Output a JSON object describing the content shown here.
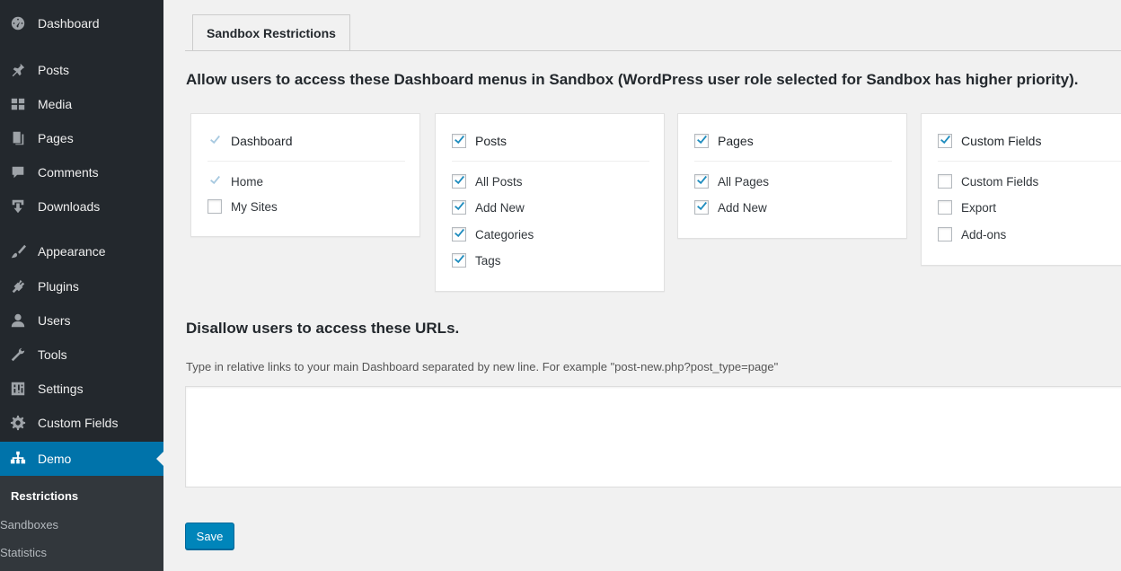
{
  "sidebar": {
    "items": [
      {
        "label": "Dashboard",
        "icon": "dashboard-icon"
      },
      {
        "label": "Posts",
        "icon": "pin-icon"
      },
      {
        "label": "Media",
        "icon": "media-icon"
      },
      {
        "label": "Pages",
        "icon": "pages-icon"
      },
      {
        "label": "Comments",
        "icon": "comment-icon"
      },
      {
        "label": "Downloads",
        "icon": "download-icon"
      },
      {
        "label": "Appearance",
        "icon": "brush-icon"
      },
      {
        "label": "Plugins",
        "icon": "plug-icon"
      },
      {
        "label": "Users",
        "icon": "user-icon"
      },
      {
        "label": "Tools",
        "icon": "wrench-icon"
      },
      {
        "label": "Settings",
        "icon": "settings-icon"
      },
      {
        "label": "Custom Fields",
        "icon": "gear-icon"
      },
      {
        "label": "Demo",
        "icon": "sitemap-icon",
        "current": true
      }
    ],
    "submenu": [
      "Restrictions",
      "Sandboxes",
      "Statistics"
    ],
    "active_sub": "Restrictions"
  },
  "tab": {
    "label": "Sandbox Restrictions"
  },
  "allow_heading": "Allow users to access these Dashboard menus in Sandbox (WordPress user role selected for Sandbox has higher priority).",
  "cards": [
    {
      "title": "Dashboard",
      "checked": true,
      "disabled": true,
      "options": [
        {
          "label": "Home",
          "checked": true,
          "disabled": true
        },
        {
          "label": "My Sites",
          "checked": false
        }
      ]
    },
    {
      "title": "Posts",
      "checked": true,
      "options": [
        {
          "label": "All Posts",
          "checked": true
        },
        {
          "label": "Add New",
          "checked": true
        },
        {
          "label": "Categories",
          "checked": true
        },
        {
          "label": "Tags",
          "checked": true
        }
      ]
    },
    {
      "title": "Pages",
      "checked": true,
      "options": [
        {
          "label": "All Pages",
          "checked": true
        },
        {
          "label": "Add New",
          "checked": true
        }
      ]
    },
    {
      "title": "Custom Fields",
      "checked": true,
      "options": [
        {
          "label": "Custom Fields",
          "checked": false
        },
        {
          "label": "Export",
          "checked": false
        },
        {
          "label": "Add-ons",
          "checked": false
        }
      ]
    }
  ],
  "disallow_heading": "Disallow users to access these URLs.",
  "help_text": "Type in relative links to your main Dashboard separated by new line. For example \"post-new.php?post_type=page\"",
  "urls_value": "",
  "save_label": "Save",
  "colors": {
    "sidebar_bg": "#23282d",
    "accent": "#0073aa",
    "button": "#0085ba",
    "check": "#1e8cbe"
  }
}
